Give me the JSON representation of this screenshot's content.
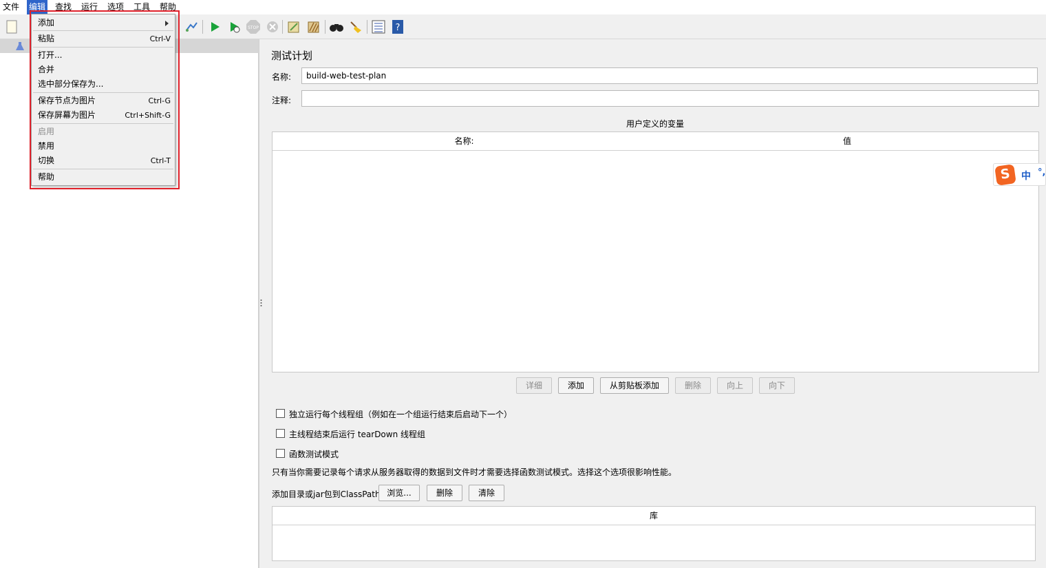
{
  "menubar": {
    "items": [
      "文件",
      "编辑",
      "查找",
      "运行",
      "选项",
      "工具",
      "帮助"
    ],
    "active": "编辑"
  },
  "toolbar": {
    "icons": [
      "new-icon",
      "templates-icon",
      "expand-icon",
      "start-icon",
      "start-no-timers-icon",
      "stop-icon",
      "shutdown-icon",
      "clear-icon",
      "clear-all-icon",
      "search-icon",
      "reset-search-icon",
      "function-helper-icon",
      "help-icon"
    ]
  },
  "edit_menu": {
    "items": [
      {
        "label": "添加",
        "shortcut": "",
        "submenu": true
      },
      {
        "label": "粘贴",
        "shortcut": "Ctrl-V"
      },
      {
        "label": "打开...",
        "shortcut": ""
      },
      {
        "label": "合并",
        "shortcut": ""
      },
      {
        "label": "选中部分保存为...",
        "shortcut": ""
      },
      {
        "label": "保存节点为图片",
        "shortcut": "Ctrl-G"
      },
      {
        "label": "保存屏幕为图片",
        "shortcut": "Ctrl+Shift-G"
      },
      {
        "label": "启用",
        "shortcut": "",
        "disabled": true
      },
      {
        "label": "禁用",
        "shortcut": ""
      },
      {
        "label": "切换",
        "shortcut": "Ctrl-T"
      },
      {
        "label": "帮助",
        "shortcut": ""
      }
    ]
  },
  "panel": {
    "title": "测试计划",
    "name_label": "名称:",
    "name_value": "build-web-test-plan",
    "comment_label": "注释:",
    "comment_value": "",
    "vars_title": "用户定义的变量",
    "vars_columns": [
      "名称:",
      "值"
    ],
    "buttons": [
      {
        "label": "详细",
        "disabled": true
      },
      {
        "label": "添加",
        "disabled": false
      },
      {
        "label": "从剪贴板添加",
        "disabled": false
      },
      {
        "label": "删除",
        "disabled": true
      },
      {
        "label": "向上",
        "disabled": true
      },
      {
        "label": "向下",
        "disabled": true
      }
    ],
    "checkboxes": [
      {
        "label": "独立运行每个线程组（例如在一个组运行结束后启动下一个）",
        "checked": false
      },
      {
        "label": "主线程结束后运行 tearDown 线程组",
        "checked": false
      },
      {
        "label": "函数测试模式",
        "checked": false
      }
    ],
    "functional_note": "只有当你需要记录每个请求从服务器取得的数据到文件时才需要选择函数测试模式。选择这个选项很影响性能。",
    "classpath_label": "添加目录或jar包到ClassPath",
    "classpath_buttons": [
      "浏览...",
      "删除",
      "清除"
    ],
    "lib_column": "库"
  },
  "ime": {
    "mode": "中",
    "punct": "°,"
  },
  "colors": {
    "highlight_box": "#e0202a",
    "menu_active": "#2f65ca"
  }
}
